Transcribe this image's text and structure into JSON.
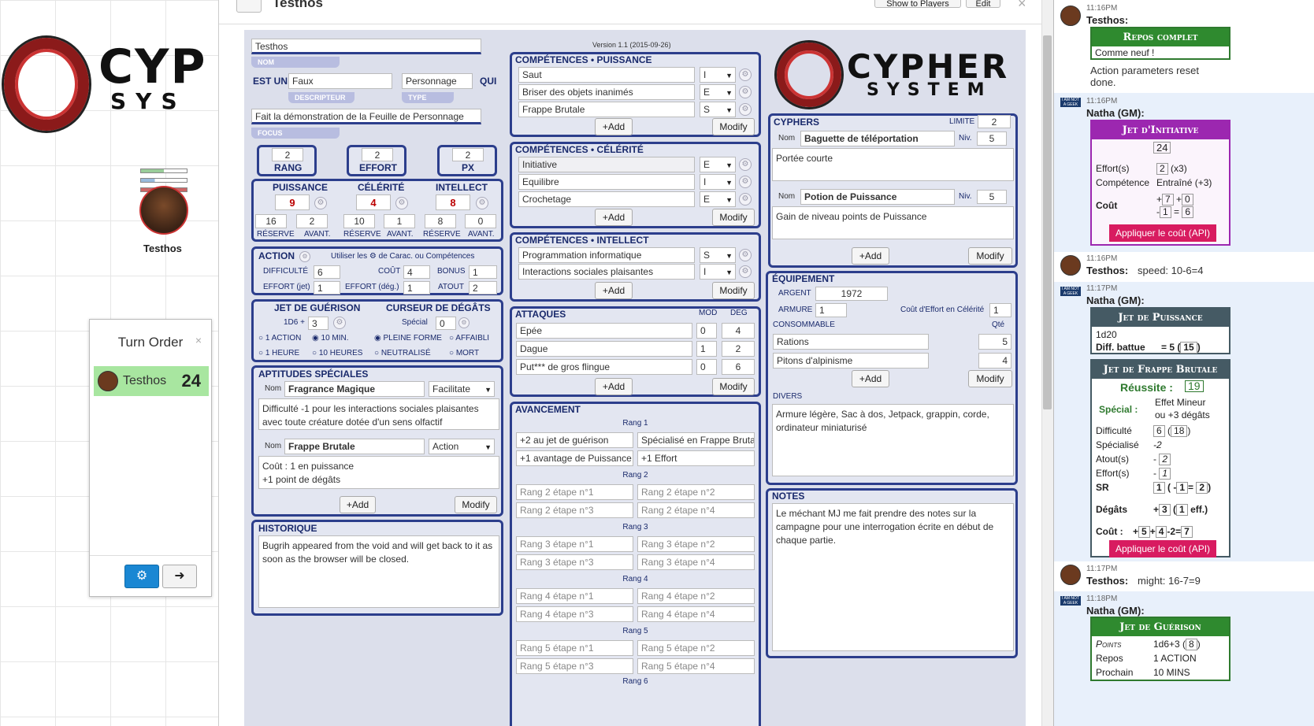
{
  "map": {
    "logo_text_top": "CYP",
    "logo_text_bottom": "SYS",
    "token_name": "Testhos"
  },
  "turn_order": {
    "title": "Turn Order",
    "close": "×",
    "entry_name": "Testhos",
    "entry_value": "24",
    "gear": "⚙",
    "arrow": "➜"
  },
  "sheet_header": {
    "title": "Testhos",
    "show_players": "Show to Players",
    "edit": "Edit",
    "close": "×"
  },
  "version": "Version 1.1 (2015-09-26)",
  "identity": {
    "name": "Testhos",
    "name_label": "NOM",
    "est_un": "EST UN",
    "descriptor": "Faux",
    "descriptor_label": "DESCRIPTEUR",
    "type": "Personnage",
    "type_label": "TYPE",
    "qui": "QUI",
    "focus": "Fait la démonstration de la Feuille de Personnage",
    "focus_label": "FOCUS"
  },
  "tier": {
    "rang": "2",
    "rang_label": "RANG",
    "effort": "2",
    "effort_label": "EFFORT",
    "px": "2",
    "px_label": "PX"
  },
  "pools": {
    "puissance": "PUISSANCE",
    "celerite": "CÉLÉRITÉ",
    "intellect": "INTELLECT",
    "p_val": "9",
    "c_val": "4",
    "i_val": "8",
    "p_max": "16",
    "p_edge": "2",
    "c_max": "10",
    "c_edge": "1",
    "i_max": "8",
    "i_edge": "0",
    "reserve": "RÉSERVE",
    "avant": "AVANT."
  },
  "action": {
    "label": "ACTION",
    "hint": "Utiliser les ⚙ de Carac. ou Compétences",
    "difficulte_label": "DIFFICULTÉ",
    "difficulte": "6",
    "cout_label": "COÛT",
    "cout": "4",
    "bonus_label": "BONUS",
    "bonus": "1",
    "effort_jet_label": "EFFORT (jet)",
    "effort_jet": "1",
    "effort_deg_label": "EFFORT (dég.)",
    "effort_deg": "1",
    "atout_label": "ATOUT",
    "atout": "2"
  },
  "recovery": {
    "label": "JET DE GUÉRISON",
    "die": "1D6 +",
    "bonus": "3",
    "r1": "1 ACTION",
    "r2": "10 MIN.",
    "r3": "1 HEURE",
    "r4": "10 HEURES"
  },
  "damage": {
    "label": "CURSEUR DE DÉGÂTS",
    "special": "Spécial",
    "special_val": "0",
    "d1": "PLEINE FORME",
    "d2": "AFFAIBLI",
    "d3": "NEUTRALISÉ",
    "d4": "MORT"
  },
  "abilities": {
    "label": "APTITUDES SPÉCIALES",
    "nom": "Nom",
    "a1_name": "Fragrance Magique",
    "a1_type": "Facilitate",
    "a1_desc": "Difficulté -1 pour les interactions sociales plaisantes avec toute créature dotée d'un sens olfactif",
    "a2_name": "Frappe Brutale",
    "a2_type": "Action",
    "a2_desc1": "Coût : 1 en puissance",
    "a2_desc2": "+1 point de dégâts",
    "add": "+Add",
    "modify": "Modify"
  },
  "history": {
    "label": "HISTORIQUE",
    "text": "Bugrih appeared from the void and will get back to it as soon as the browser will be closed."
  },
  "skills_p": {
    "label": "COMPÉTENCES • PUISSANCE",
    "s1": "Saut",
    "s1l": "I",
    "s2": "Briser des objets inanimés",
    "s2l": "E",
    "s3": "Frappe Brutale",
    "s3l": "S",
    "add": "+Add",
    "modify": "Modify"
  },
  "skills_c": {
    "label": "COMPÉTENCES • CÉLÉRITÉ",
    "s1": "Initiative",
    "s1l": "E",
    "s2": "Equilibre",
    "s2l": "I",
    "s3": "Crochetage",
    "s3l": "E",
    "add": "+Add",
    "modify": "Modify"
  },
  "skills_i": {
    "label": "COMPÉTENCES • INTELLECT",
    "s1": "Programmation informatique",
    "s1l": "S",
    "s2": "Interactions sociales plaisantes",
    "s2l": "I",
    "add": "+Add",
    "modify": "Modify"
  },
  "attacks": {
    "label": "ATTAQUES",
    "mod": "MOD",
    "deg": "DEG",
    "a1": "Epée",
    "a1m": "0",
    "a1d": "4",
    "a2": "Dague",
    "a2m": "1",
    "a2d": "2",
    "a3": "Put*** de gros flingue",
    "a3m": "0",
    "a3d": "6",
    "add": "+Add",
    "modify": "Modify"
  },
  "advancement": {
    "label": "AVANCEMENT",
    "r1": "Rang 1",
    "r1a": "+2 au jet de guérison",
    "r1b": "Spécialisé en Frappe Brutale",
    "r1c": "+1 avantage de Puissance",
    "r1d": "+1 Effort",
    "r2": "Rang 2",
    "r2a": "Rang 2 étape n°1",
    "r2b": "Rang 2 étape n°2",
    "r2c": "Rang 2 étape n°3",
    "r2d": "Rang 2 étape n°4",
    "r3": "Rang 3",
    "r3a": "Rang 3 étape n°1",
    "r3b": "Rang 3 étape n°2",
    "r3c": "Rang 3 étape n°3",
    "r3d": "Rang 3 étape n°4",
    "r4": "Rang 4",
    "r4a": "Rang 4 étape n°1",
    "r4b": "Rang 4 étape n°2",
    "r4c": "Rang 4 étape n°3",
    "r4d": "Rang 4 étape n°4",
    "r5": "Rang 5",
    "r5a": "Rang 5 étape n°1",
    "r5b": "Rang 5 étape n°2",
    "r5c": "Rang 5 étape n°3",
    "r5d": "Rang 5 étape n°4",
    "r6": "Rang 6"
  },
  "logo": {
    "top": "CYPHER",
    "bottom": "SYSTEM"
  },
  "cyphers": {
    "label": "CYPHERS",
    "limite_label": "LIMITE",
    "limite": "2",
    "nom": "Nom",
    "niv": "Niv.",
    "c1": "Baguette de téléportation",
    "c1n": "5",
    "c1d": "Portée courte",
    "c2": "Potion de Puissance",
    "c2n": "5",
    "c2d": "Gain de niveau points de Puissance",
    "add": "+Add",
    "modify": "Modify"
  },
  "equipment": {
    "label": "ÉQUIPEMENT",
    "argent_label": "ARGENT",
    "argent": "1972",
    "armure_label": "ARMURE",
    "armure": "1",
    "cout_label": "Coût d'Effort en Célérité",
    "cout": "1",
    "consommable": "CONSOMMABLE",
    "qte": "Qté",
    "i1": "Rations",
    "i1q": "5",
    "i2": "Pitons d'alpinisme",
    "i2q": "4",
    "add": "+Add",
    "modify": "Modify",
    "divers": "DIVERS",
    "divers_text": "Armure légère, Sac à dos, Jetpack, grappin, corde, ordinateur miniaturisé"
  },
  "notes": {
    "label": "NOTES",
    "text": "Le méchant MJ me fait prendre des notes sur la campagne pour une interrogation écrite en début de chaque partie."
  },
  "chat": {
    "m1_time": "11:16PM",
    "m1_who": "Testhos:",
    "m1_card": "Repos complet",
    "m1_sub": "Comme neuf !",
    "m1_txt": "Action parameters reset done.",
    "m2_time": "11:16PM",
    "m2_who": "Natha (GM):",
    "m2_card": "Jet d'Initiative",
    "m2_val": "24",
    "m2_eff": "Effort(s)",
    "m2_effv": "2",
    "m2_effx": "(x3)",
    "m2_comp": "Compétence",
    "m2_compv": "Entraîné (+3)",
    "m2_cout": "Coût",
    "m2_c1": "7",
    "m2_c2": "0",
    "m2_c3": "1",
    "m2_c4": "6",
    "m2_api": "Appliquer le coût (API)",
    "m3_time": "11:16PM",
    "m3_who": "Testhos:",
    "m3_txt": "speed: 10-6=4",
    "m4_time": "11:17PM",
    "m4_who": "Natha (GM):",
    "m4_card": "Jet de Puissance",
    "m4_die": "1d20",
    "m4_diff": "Diff. battue",
    "m4_diffv": "= 5 (",
    "m4_diffb": "15",
    "m4_card2": "Jet de Frappe Brutale",
    "m4_reussite": "Réussite :",
    "m4_rv": "19",
    "m4_special": "Spécial :",
    "m4_sp1": "Effet Mineur",
    "m4_sp2": "ou +3 dégâts",
    "m4_diff2": "Difficulté",
    "m4_diff2a": "6",
    "m4_diff2b": "18",
    "m4_spec": "Spécialisé",
    "m4_specv": "-2",
    "m4_atout": "Atout(s)",
    "m4_atoutv": "2",
    "m4_effort": "Effort(s)",
    "m4_effortv": "1",
    "m4_sr": "SR",
    "m4_sr1": "1",
    "m4_sr2": "1",
    "m4_sr3": "2",
    "m4_deg": "Dégâts",
    "m4_degv": "3",
    "m4_dege": "1",
    "m4_cout": "Coût :",
    "m4_cout1": "5",
    "m4_cout2": "4",
    "m4_cout3": "7",
    "m4_api": "Appliquer le coût (API)",
    "m5_time": "11:17PM",
    "m5_who": "Testhos:",
    "m5_txt": "might: 16-7=9",
    "m6_time": "11:18PM",
    "m6_who": "Natha (GM):",
    "m6_card": "Jet de Guérison",
    "m6_pts": "Points",
    "m6_ptsv": "1d6+3 (",
    "m6_ptsb": "8",
    "m6_repos": "Repos",
    "m6_reposv": "1 ACTION",
    "m6_proch": "Prochain",
    "m6_prochv": "10 MINS"
  }
}
